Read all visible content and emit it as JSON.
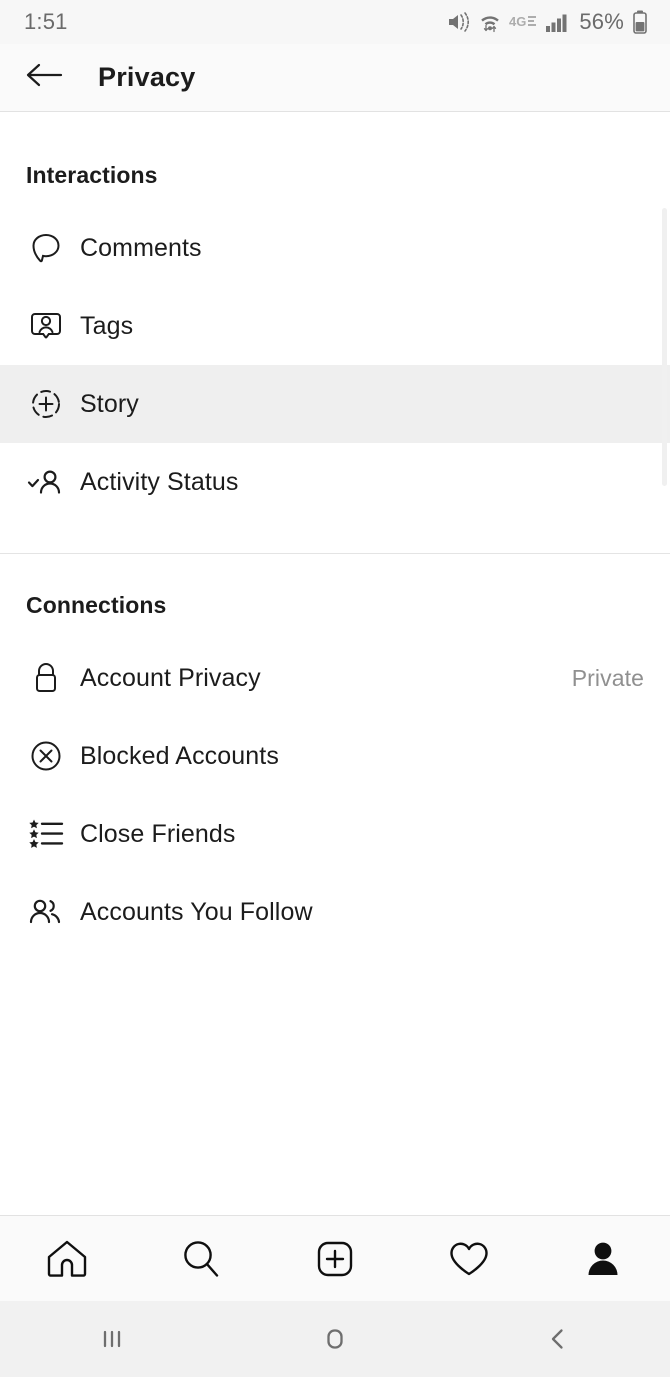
{
  "status_bar": {
    "time": "1:51",
    "battery_percent": "56%",
    "icons": [
      "mute-vibrate-icon",
      "wifi-icon",
      "4g-lte-icon",
      "signal-bars-icon",
      "battery-icon"
    ]
  },
  "header": {
    "back_icon": "back-arrow-icon",
    "title": "Privacy"
  },
  "sections": [
    {
      "title": "Interactions",
      "items": [
        {
          "label": "Comments",
          "icon": "comment-bubble-icon",
          "value": "",
          "highlighted": false
        },
        {
          "label": "Tags",
          "icon": "tag-person-icon",
          "value": "",
          "highlighted": false
        },
        {
          "label": "Story",
          "icon": "story-plus-circle-icon",
          "value": "",
          "highlighted": true
        },
        {
          "label": "Activity Status",
          "icon": "activity-check-person-icon",
          "value": "",
          "highlighted": false
        }
      ]
    },
    {
      "title": "Connections",
      "items": [
        {
          "label": "Account Privacy",
          "icon": "lock-icon",
          "value": "Private",
          "highlighted": false
        },
        {
          "label": "Blocked Accounts",
          "icon": "block-circle-x-icon",
          "value": "",
          "highlighted": false
        },
        {
          "label": "Close Friends",
          "icon": "star-list-icon",
          "value": "",
          "highlighted": false
        },
        {
          "label": "Accounts You Follow",
          "icon": "people-icon",
          "value": "",
          "highlighted": false
        }
      ]
    }
  ],
  "tabbar": {
    "items": [
      {
        "name": "home-icon",
        "label": "Home",
        "active": false
      },
      {
        "name": "search-icon",
        "label": "Search",
        "active": false
      },
      {
        "name": "add-post-icon",
        "label": "New Post",
        "active": false
      },
      {
        "name": "heart-icon",
        "label": "Activity",
        "active": false
      },
      {
        "name": "profile-icon",
        "label": "Profile",
        "active": true
      }
    ]
  },
  "navbar": {
    "items": [
      {
        "name": "recents-icon",
        "label": "Recents"
      },
      {
        "name": "home-button-icon",
        "label": "Home"
      },
      {
        "name": "back-button-icon",
        "label": "Back"
      }
    ]
  },
  "colors": {
    "text": "#1c1c1c",
    "muted": "#909090",
    "highlight": "#efefef",
    "chrome": "#fafafa",
    "navbar": "#f1f1f1"
  }
}
